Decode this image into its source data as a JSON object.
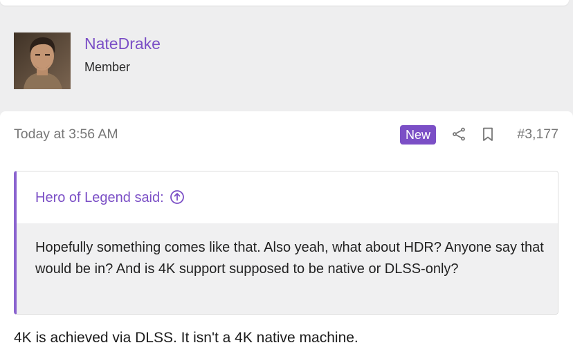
{
  "author": {
    "username": "NateDrake",
    "title": "Member"
  },
  "post": {
    "timestamp": "Today at 3:56 AM",
    "badge": "New",
    "number": "#3,177",
    "quote": {
      "source": "Hero of Legend said:",
      "text": "Hopefully something comes like that. Also yeah, what about HDR? Anyone say that would be in? And is 4K support supposed to be native or DLSS-only?"
    },
    "reply_text": "4K is achieved via DLSS. It isn't a 4K native machine."
  },
  "colors": {
    "accent": "#7b4fc6",
    "quote_border": "#8a63cf",
    "background": "#eeeeef"
  },
  "icons": {
    "share": "share-icon",
    "bookmark": "bookmark-icon",
    "quote_jump": "arrow-up-circle-icon"
  }
}
